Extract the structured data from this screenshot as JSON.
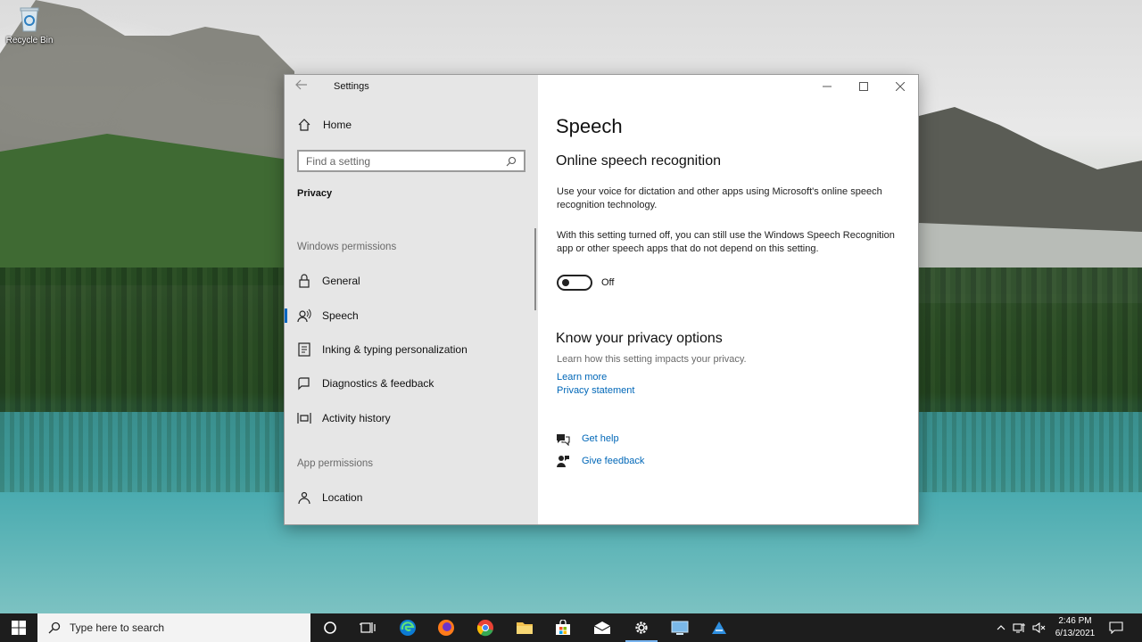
{
  "desktop": {
    "recycle_bin_label": "Recycle Bin"
  },
  "window": {
    "title": "Settings",
    "sidebar": {
      "home_label": "Home",
      "search_placeholder": "Find a setting",
      "section_label": "Privacy",
      "windows_permissions_label": "Windows permissions",
      "app_permissions_label": "App permissions",
      "items": [
        {
          "label": "General",
          "icon": "lock-icon"
        },
        {
          "label": "Speech",
          "icon": "speech-icon",
          "active": true
        },
        {
          "label": "Inking & typing personalization",
          "icon": "inking-icon"
        },
        {
          "label": "Diagnostics & feedback",
          "icon": "diagnostics-icon"
        },
        {
          "label": "Activity history",
          "icon": "activity-history-icon"
        },
        {
          "label": "Location",
          "icon": "location-icon"
        }
      ]
    },
    "content": {
      "page_title": "Speech",
      "section1_title": "Online speech recognition",
      "para1": "Use your voice for dictation and other apps using Microsoft's online speech recognition technology.",
      "para2": "With this setting turned off, you can still use the Windows Speech Recognition app or other speech apps that do not depend on this setting.",
      "toggle_state": "Off",
      "section2_title": "Know your privacy options",
      "privacy_desc": "Learn how this setting impacts your privacy.",
      "learn_more": "Learn more",
      "privacy_statement": "Privacy statement",
      "get_help": "Get help",
      "give_feedback": "Give feedback"
    }
  },
  "taskbar": {
    "search_placeholder": "Type here to search",
    "time": "2:46 PM",
    "date": "6/13/2021"
  },
  "colors": {
    "accent": "#0067c0",
    "link": "#0067b8",
    "sidebar_bg": "#e6e6e6",
    "taskbar_bg": "#1d1d1d"
  }
}
